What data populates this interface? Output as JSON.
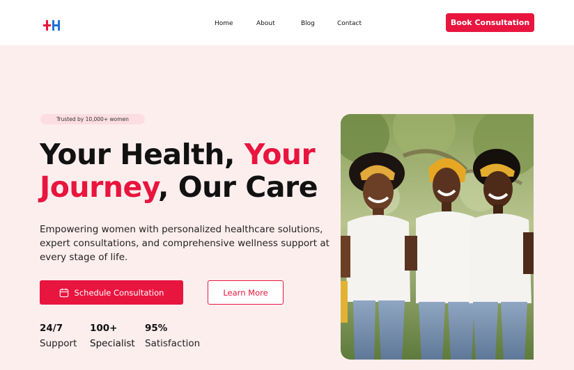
{
  "header": {
    "logo_icon": "medical-cross-logo",
    "nav": [
      {
        "label": "Home"
      },
      {
        "label": "About"
      },
      {
        "label": "Blog"
      },
      {
        "label": "Contact"
      }
    ],
    "cta_label": "Book Consultation"
  },
  "hero": {
    "badge": "Trusted by 10,000+ women",
    "title_part1": "Your Health, ",
    "title_accent1": "Your",
    "title_accent2": "Journey",
    "title_part2": ", Our Care",
    "description": "Empowering women with personalized healthcare solutions, expert consultations, and comprehensive wellness support at every stage of life.",
    "primary_button": "Schedule Consultation",
    "primary_button_icon": "calendar-icon",
    "secondary_button": "Learn More",
    "stats": [
      {
        "value": "24/7",
        "label": "Support"
      },
      {
        "value": "100+",
        "label": "Specialist"
      },
      {
        "value": "95%",
        "label": "Satisfaction"
      }
    ]
  },
  "colors": {
    "accent": "#e8153f",
    "background": "#fdeeee",
    "header_bg": "#ffffff"
  }
}
